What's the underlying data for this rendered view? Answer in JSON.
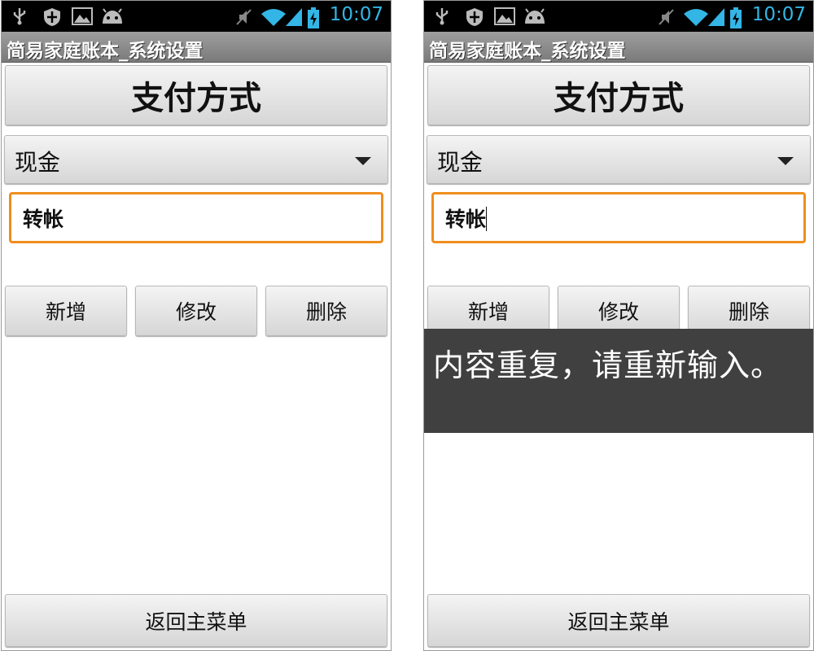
{
  "status_bar": {
    "time": "10:07",
    "left_icons": [
      "usb-icon",
      "shield-icon",
      "image-icon",
      "android-icon"
    ],
    "right_icons": [
      "mute-icon",
      "wifi-icon",
      "signal-icon",
      "battery-charging-icon"
    ],
    "accent_color": "#33b5e5"
  },
  "app": {
    "title": "简易家庭账本_系统设置"
  },
  "settings": {
    "header_button": "支付方式",
    "spinner_value": "现金",
    "input_value": "转帐",
    "input_focus_color": "#ef8e1d",
    "add_button": "新增",
    "edit_button": "修改",
    "delete_button": "删除",
    "back_button": "返回主菜单"
  },
  "toast": {
    "message": "内容重复，请重新输入。"
  }
}
